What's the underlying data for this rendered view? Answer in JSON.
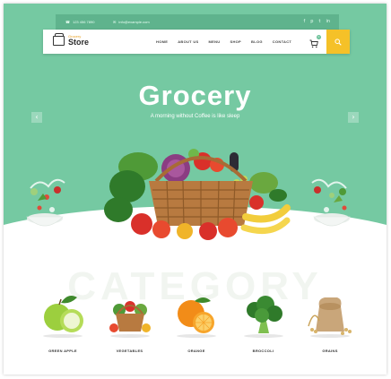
{
  "topbar": {
    "phone": "123 456 7890",
    "email": "info@example.com",
    "social_icons": [
      "facebook-icon",
      "pinterest-icon",
      "twitter-icon",
      "linkedin-icon"
    ]
  },
  "logo": {
    "small": "Grocery",
    "big": "Store"
  },
  "nav": {
    "items": [
      "HOME",
      "ABOUT US",
      "MENU",
      "SHOP",
      "BLOG",
      "CONTACT"
    ]
  },
  "cart": {
    "count": "0"
  },
  "hero": {
    "title": "Grocery",
    "subtitle": "A morning without Coffee is like sleep"
  },
  "categories": {
    "background_text": "CATEGORY",
    "items": [
      {
        "label": "GREEN APPLE",
        "icon": "green-apple-icon"
      },
      {
        "label": "VEGETABLES",
        "icon": "vegetables-icon"
      },
      {
        "label": "ORANGE",
        "icon": "orange-icon"
      },
      {
        "label": "BROCCOLI",
        "icon": "broccoli-icon"
      },
      {
        "label": "GRAINS",
        "icon": "grains-icon"
      }
    ]
  },
  "colors": {
    "hero_bg": "#75c9a2",
    "topbar_bg": "#5fb38d",
    "accent": "#f5c128"
  }
}
